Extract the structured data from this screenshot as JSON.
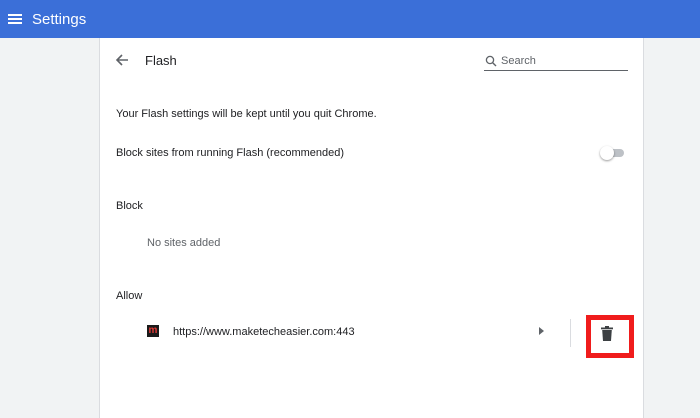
{
  "header": {
    "title": "Settings",
    "menu_icon": "menu-icon",
    "background_color": "#3b6fd8"
  },
  "page": {
    "title": "Flash",
    "back_icon": "arrow-left-icon",
    "search": {
      "placeholder": "Search",
      "value": "",
      "icon": "search-icon"
    },
    "info_text": "Your Flash settings will be kept until you quit Chrome.",
    "block_toggle": {
      "label": "Block sites from running Flash (recommended)",
      "enabled": false
    },
    "block_section": {
      "heading": "Block",
      "empty_text": "No sites added"
    },
    "allow_section": {
      "heading": "Allow",
      "sites": [
        {
          "url": "https://www.maketecheasier.com:443",
          "favicon_letter": "m",
          "favicon_color": "#e53935",
          "delete_icon": "trash-icon"
        }
      ]
    }
  },
  "colors": {
    "highlight_border": "#f01c1c"
  }
}
